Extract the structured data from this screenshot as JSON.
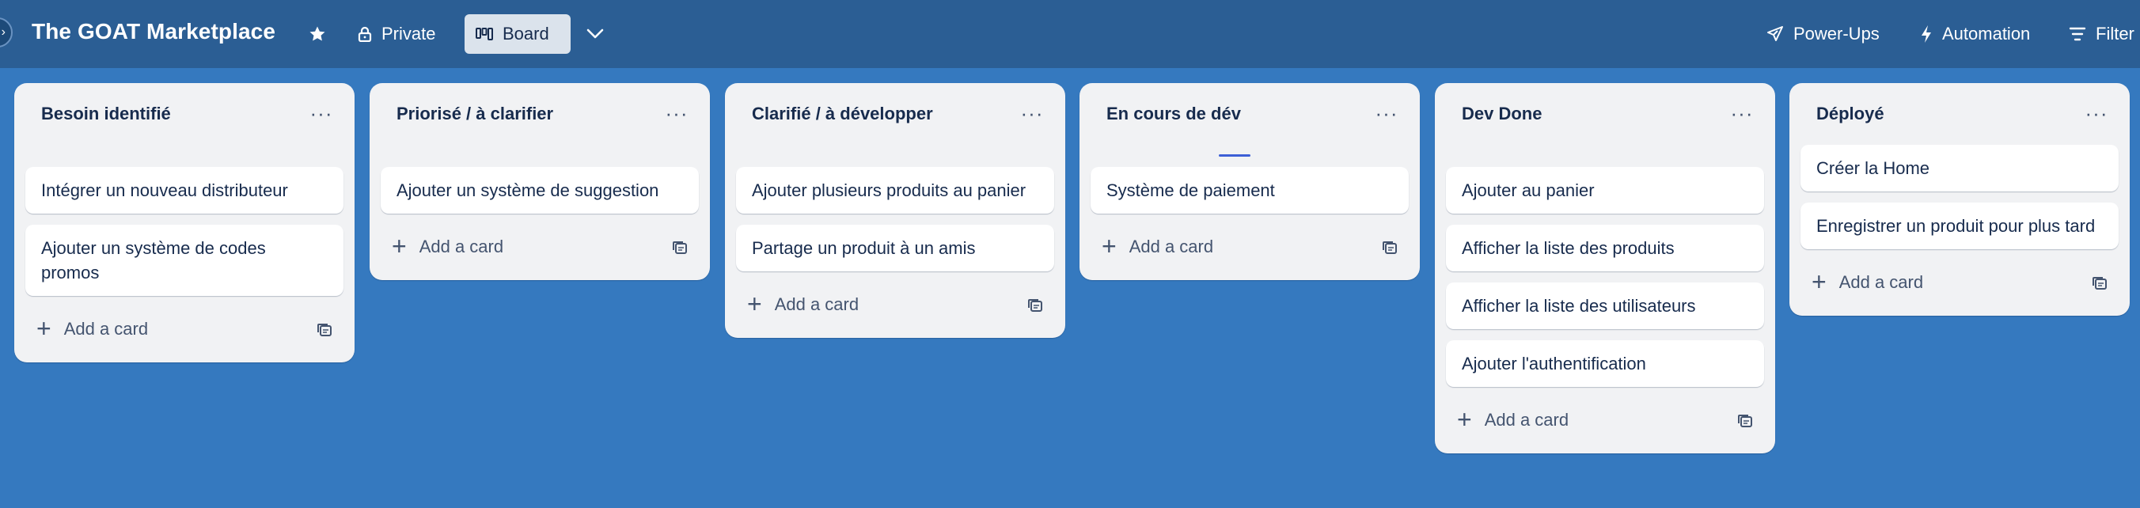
{
  "header": {
    "board_title": "The GOAT Marketplace",
    "visibility_label": "Private",
    "view_label": "Board",
    "power_ups_label": "Power-Ups",
    "automation_label": "Automation",
    "filter_label": "Filter"
  },
  "lists": [
    {
      "title": "Besoin identifié",
      "cards": [
        "Intégrer un nouveau distributeur",
        "Ajouter un système de codes promos"
      ],
      "add_label": "Add a card"
    },
    {
      "title": "Priorisé / à clarifier",
      "cards": [
        "Ajouter un système de suggestion"
      ],
      "add_label": "Add a card"
    },
    {
      "title": "Clarifié / à développer",
      "cards": [
        "Ajouter plusieurs produits au panier",
        "Partage un produit à un amis"
      ],
      "add_label": "Add a card"
    },
    {
      "title": "En cours de dév",
      "cards": [
        "Système de paiement"
      ],
      "add_label": "Add a card"
    },
    {
      "title": "Dev Done",
      "cards": [
        "Ajouter au panier",
        "Afficher la liste des produits",
        "Afficher la liste des utilisateurs",
        "Ajouter l'authentification"
      ],
      "add_label": "Add a card"
    },
    {
      "title": "Déployé",
      "cards": [
        "Créer la Home",
        "Enregistrer un produit pour plus tard"
      ],
      "add_label": "Add a card"
    }
  ],
  "colors": {
    "board_background": "#3579bf",
    "header_background": "#2b5e94",
    "list_background": "#f1f2f4",
    "active_view_background": "#dbe3ec",
    "drop_indicator": "#3d5fd6"
  }
}
